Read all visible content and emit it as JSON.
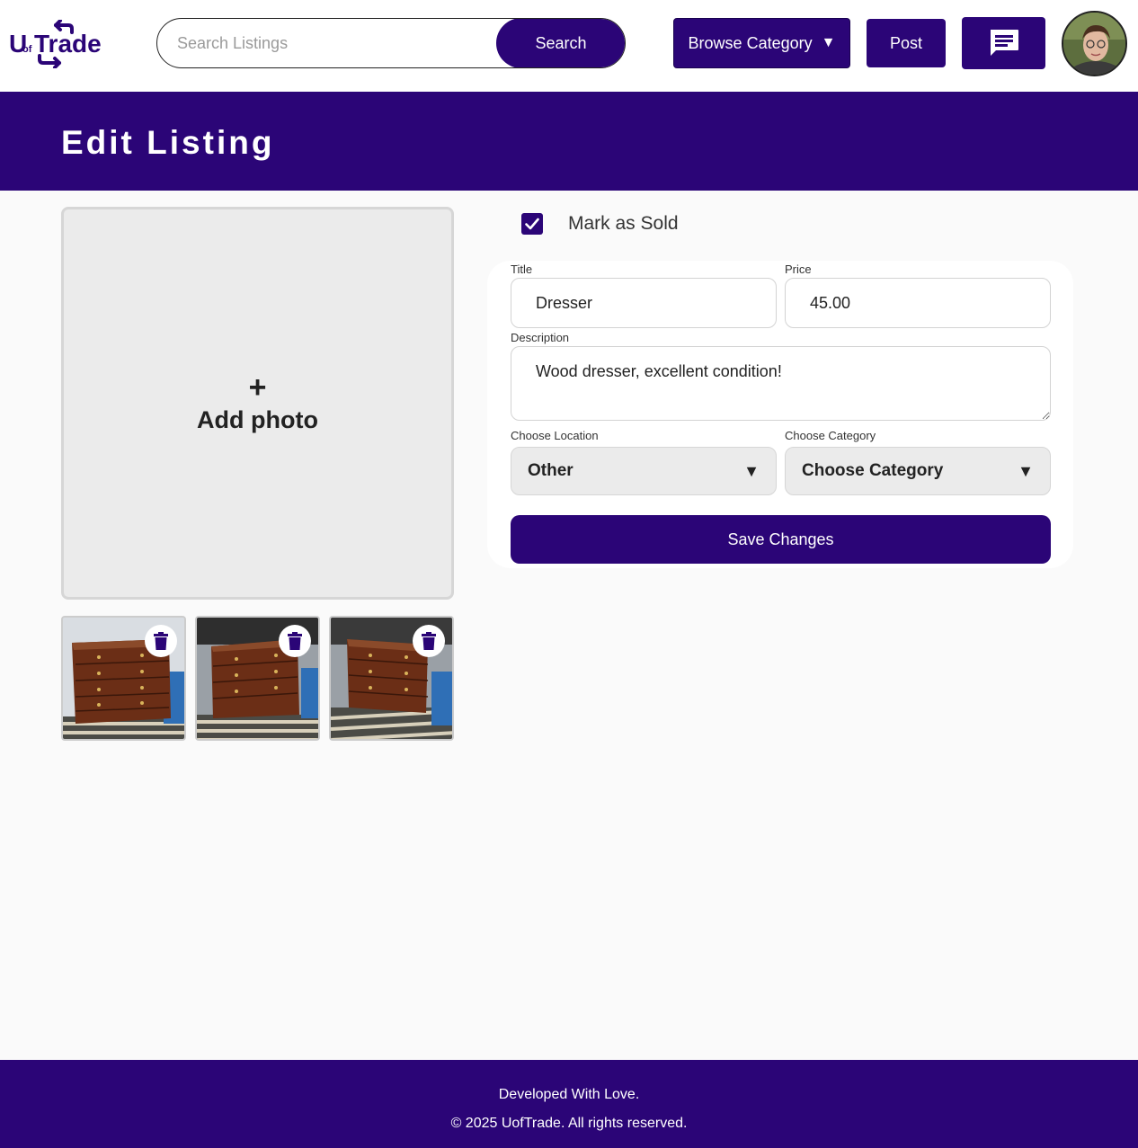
{
  "app": {
    "logo_text_small": "of",
    "logo_text_large": "UTrade"
  },
  "header": {
    "search_placeholder": "Search Listings",
    "search_label": "Search",
    "browse_label": "Browse Category",
    "browse_caret": "▼",
    "post_label": "Post",
    "messages_icon": "chat-icon",
    "avatar_icon": "user-avatar"
  },
  "banner": {
    "title": "Edit Listing"
  },
  "photos": {
    "add_plus": "+",
    "add_label": "Add photo",
    "thumbnails": [
      {
        "alt": "dresser-photo-1",
        "delete_icon": "trash-icon"
      },
      {
        "alt": "dresser-photo-2",
        "delete_icon": "trash-icon"
      },
      {
        "alt": "dresser-photo-3",
        "delete_icon": "trash-icon"
      }
    ]
  },
  "form": {
    "sold_label": "Mark as Sold",
    "sold_checked": true,
    "title_label": "Title",
    "title_value": "Dresser",
    "price_label": "Price",
    "price_value": "45.00",
    "description_label": "Description",
    "description_value": "Wood dresser, excellent condition!",
    "location_label": "Choose Location",
    "location_value": "Other",
    "category_label": "Choose Category",
    "category_value": "Choose Category",
    "select_caret": "▼",
    "save_label": "Save Changes"
  },
  "footer": {
    "line1": "Developed With Love.",
    "line2": "© 2025 UofTrade. All rights reserved."
  },
  "colors": {
    "brand": "#2b0577",
    "background": "#fafafa",
    "field_gray": "#ebebeb"
  }
}
